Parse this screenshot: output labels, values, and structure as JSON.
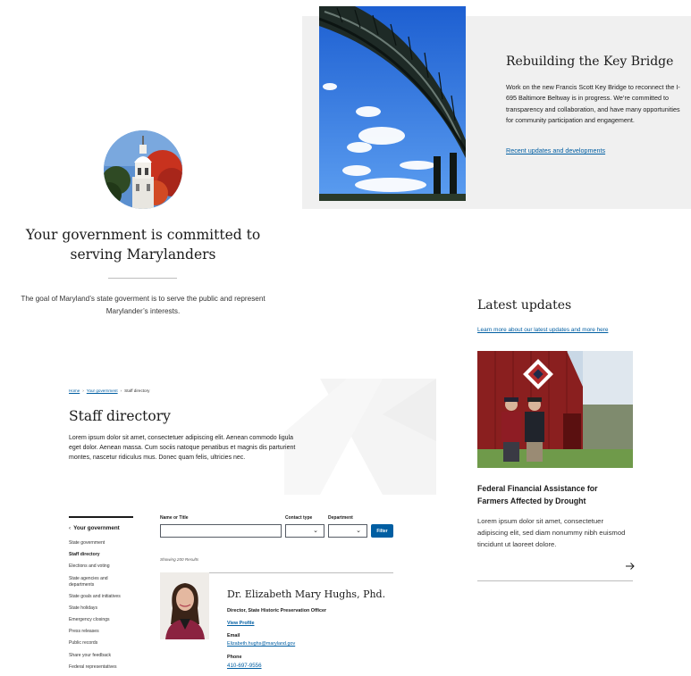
{
  "committed": {
    "title": "Your government is committed to serving Marylanders",
    "text": "The goal of Maryland’s state goverment is to serve the public and represent Marylander’s interests."
  },
  "bridge": {
    "title": "Rebuilding the Key Bridge",
    "body": "Work on the new Francis Scott Key Bridge to reconnect the I-695 Baltimore Beltway is in progress. We’re committed to transparency and collaboration, and have many opportunities for community participation and engagement.",
    "link": "Recent updates and developments"
  },
  "latest": {
    "title": "Latest updates",
    "link": "Learn more about our latest updates and more here",
    "card_title": "Federal Financial Assistance for Farmers Affected by Drought",
    "card_body": "Lorem ipsum dolor sit amet, consectetuer adipiscing elit, sed diam nonummy nibh euismod tincidunt ut laoreet dolore."
  },
  "staff": {
    "breadcrumb": [
      "Home",
      "Your government",
      "Staff directory"
    ],
    "title": "Staff directory",
    "description": "Lorem ipsum dolor sit amet, consectetuer adipiscing elit. Aenean commodo ligula eget dolor. Aenean massa. Cum sociis natoque penatibus et magnis dis parturient montes, nascetur ridiculus mus. Donec quam felis, ultricies nec.",
    "sidenav": {
      "back": "Your government",
      "items": [
        "State government",
        "Staff directory",
        "Elections and voting",
        "State agencies and departments",
        "State goals and initiatives",
        "State holidays",
        "Emergency closings",
        "Press releases",
        "Public records",
        "Share your feedback",
        "Federal representatives"
      ]
    },
    "filters": {
      "name_label": "Name or Title",
      "contact_label": "Contact type",
      "dept_label": "Department",
      "button": "Filter"
    },
    "results": "Showing 200 Results",
    "profile": {
      "name": "Dr. Elizabeth Mary Hughs, Phd.",
      "role": "Director,  State Historic Preservation Officer",
      "view": "View Profile",
      "email_label": "Email",
      "email": "Elizabeth.hughs@maryland.gov",
      "phone_label": "Phone",
      "phone": "410-697-9556"
    }
  },
  "colors": {
    "link": "#005ea2",
    "button": "#005ea2",
    "panel": "#f0f0f0",
    "rule": "#bdbdbd"
  },
  "icons": [
    "chevron-left-icon",
    "chevron-down-icon",
    "arrow-right-icon"
  ]
}
